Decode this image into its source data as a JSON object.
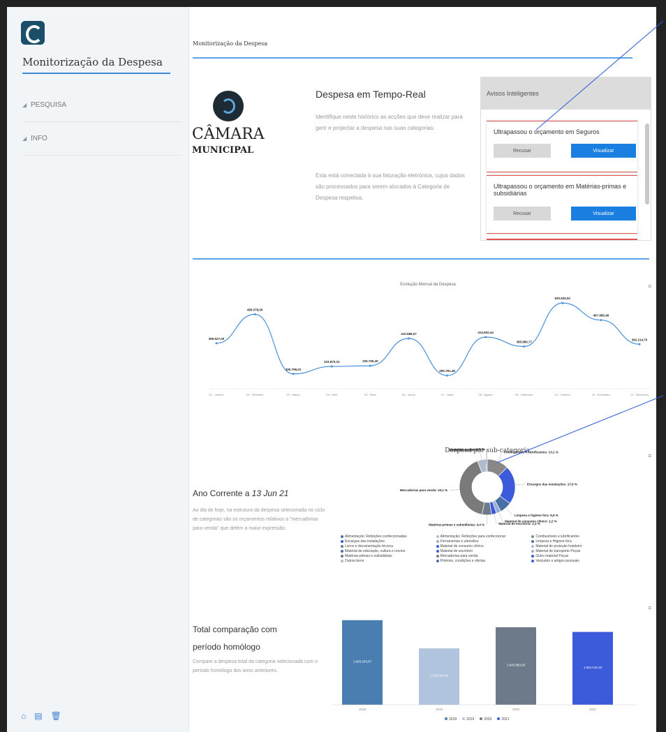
{
  "sidebar": {
    "app_title": "Monitorização da Despesa",
    "nav": [
      "PESQUISA",
      "INFO"
    ],
    "bottom_icons": [
      "home-icon",
      "document-icon",
      "trash-icon"
    ],
    "accent": "#3f8ad6"
  },
  "header": {
    "breadcrumb": "Monitorização da Despesa"
  },
  "brand": {
    "line1": "CÂMARA",
    "line2": "MUNICIPAL"
  },
  "intro": {
    "title": "Despesa em Tempo-Real",
    "paragraph1": "Identifique neste histórico as acções que deve realizar para gerir e projectar a despesa nas suas categorias.",
    "paragraph2": "Esta está conectada à sua faturação eletrónica, cujos dados são processados para serem alocados à Categoria de Despesa respetiva."
  },
  "alerts": {
    "title": "Avisos Inteligentes",
    "items": [
      {
        "text": "Ultrapassou o orçamento em Seguros",
        "reject": "Recusar",
        "view": "Visualizar"
      },
      {
        "text": "Ultrapassou o orçamento em Matérias-primas e subsidiárias",
        "reject": "Recusar",
        "view": "Visualizar"
      }
    ]
  },
  "menu_icon": "≡",
  "line_chart_data": {
    "type": "line",
    "title": "Evolução Mensal da Despesa",
    "categories": [
      "01 - Janeiro",
      "02 - Fevereiro",
      "03 - Março",
      "04 - Abril",
      "05 - Maio",
      "06 - Junho",
      "07 - Julho",
      "08 - Agosto",
      "09 - Setembro",
      "10 - Outubro",
      "11 - Novembro",
      "12 - Dezembro"
    ],
    "values": [
      395,
      485,
      300,
      323,
      325,
      410,
      295,
      414,
      385,
      520,
      467,
      392
    ],
    "value_labels": [
      "395.527,00",
      "485.078,00",
      "300.796,01",
      "323.870,31",
      "325.705,40",
      "410.586,07",
      "295.781,48",
      "414.902,44",
      "385.880,77",
      "520.630,91",
      "467.885,48",
      "392.214,70"
    ],
    "color": "#4a90d9",
    "grid": false
  },
  "donut": {
    "title": "Despesa por sub-categoria",
    "year_heading_prefix": "Ano Corrente a ",
    "year_heading_date": "13 Jun 21",
    "paragraph": "Ao dia de hoje, na estrutura da despesa selecionada no ciclo de categorias são os orçamentos relativos a \"mercadorias para venda\" que detêm a maior expressão.",
    "slices": [
      {
        "label": "Combustíveis e lubrificantes: 10,1 %",
        "value": 10.1,
        "color": "#888888"
      },
      {
        "label": "Encargos das instalações: 17,9 %",
        "value": 17.9,
        "color": "#3b5bdb"
      },
      {
        "label": "Limpeza e higiene fora: 5,6 %",
        "value": 5.6,
        "color": "#4a6fa5"
      },
      {
        "label": "Material de consumo clínico: 2,2 %",
        "value": 2.2,
        "color": "#9aaed1"
      },
      {
        "label": "Material de escritório: 2,3 %",
        "value": 2.3,
        "color": "#3b5bdb"
      },
      {
        "label": "Matérias-primas e subsidiárias: 4,4 %",
        "value": 4.4,
        "color": "#6c7a89"
      },
      {
        "label": "Mercadorias para venda: 33,1 %",
        "value": 33.1,
        "color": "#7a7a7a"
      },
      {
        "label": "Outros bens: 4,0 %",
        "value": 4.0,
        "color": "#b0bccd"
      },
      {
        "label": "Vestuário e cal...: 0,5 %",
        "value": 0.5,
        "color": "#1f2f6e"
      },
      {
        "label": "...sso: 0,1 %",
        "value": 0.1,
        "color": "#4a90d9"
      }
    ],
    "legend": [
      {
        "name": "Alimentação: Refeições confeccionadas",
        "color": "#4a6fa5"
      },
      {
        "name": "Alimentação: Refeições para confeccionar",
        "color": "#b0bccd"
      },
      {
        "name": "Combustíveis e lubrificantes",
        "color": "#888888"
      },
      {
        "name": "Encargos das instalações",
        "color": "#3b5bdb"
      },
      {
        "name": "Ferramentas e utensílios",
        "color": "#9aaed1"
      },
      {
        "name": "Limpeza e Higiene fora",
        "color": "#4a6fa5"
      },
      {
        "name": "Livros e documentação técnica",
        "color": "#6c7a89"
      },
      {
        "name": "Material de consumo clínico",
        "color": "#3b5bdb"
      },
      {
        "name": "Material de proteção hoteleiro",
        "color": "#b0bccd"
      },
      {
        "name": "Material de educação, cultura e recreio",
        "color": "#4a6fa5"
      },
      {
        "name": "Material de escritório",
        "color": "#3b5bdb"
      },
      {
        "name": "Material de transporte Peças",
        "color": "#9aaed1"
      },
      {
        "name": "Matérias-primas e subsidiárias",
        "color": "#6c7a89"
      },
      {
        "name": "Mercadorias para venda",
        "color": "#7a7a7a"
      },
      {
        "name": "Outro material Peças",
        "color": "#3b5bdb"
      },
      {
        "name": "Outros bens",
        "color": "#b0bccd"
      },
      {
        "name": "Prémios, condições e ofertas",
        "color": "#4a6fa5"
      },
      {
        "name": "Vestuário e artigos pessoais",
        "color": "#3b5bdb"
      }
    ]
  },
  "bars": {
    "title": "Total comparação com",
    "title2": "período homólogo",
    "paragraph": "Compare a despesa total da categoria selecionada com o período homólogo dos anos anteriores.",
    "chart_data": {
      "type": "bar",
      "categories": [
        "2018",
        "2019",
        "2020",
        "2021"
      ],
      "values": [
        180,
        120,
        165,
        155
      ],
      "value_labels": [
        "1.803.533,67",
        "1.239.589,00",
        "1.645.860,60",
        "1.554.615,19"
      ],
      "colors": [
        "#4a7eb0",
        "#b0c4de",
        "#6c7a89",
        "#3b5bdb"
      ],
      "legend": [
        "2018",
        "2019",
        "2020",
        "2021"
      ]
    }
  }
}
